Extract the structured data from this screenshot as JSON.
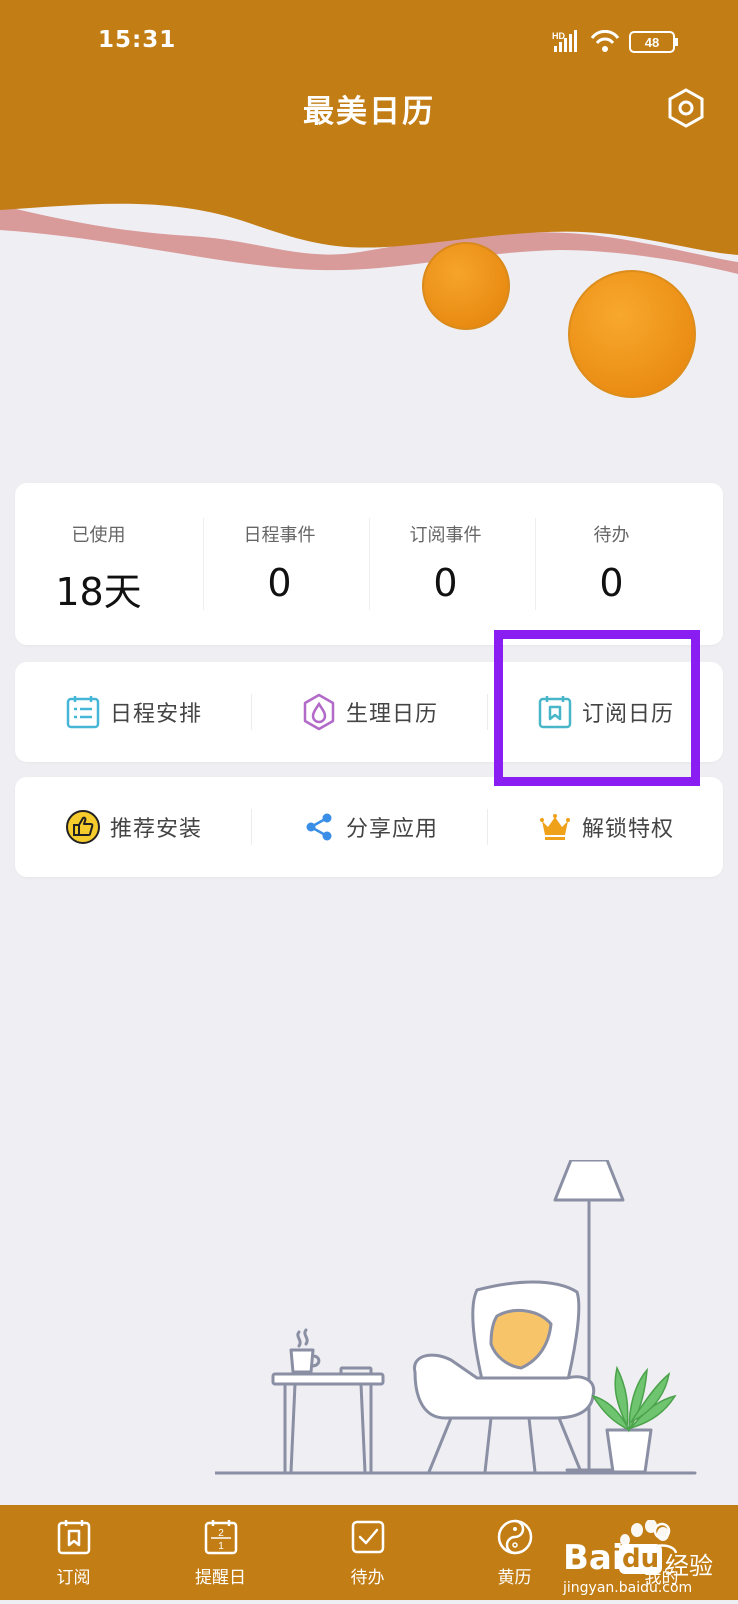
{
  "status_bar": {
    "time": "15:31",
    "network": "HD",
    "battery": "48"
  },
  "header": {
    "title": "最美日历",
    "settings_icon": "hexagon-settings-icon"
  },
  "stats": [
    {
      "label": "已使用",
      "value": "18天"
    },
    {
      "label": "日程事件",
      "value": "0"
    },
    {
      "label": "订阅事件",
      "value": "0"
    },
    {
      "label": "待办",
      "value": "0"
    }
  ],
  "features": {
    "row1": [
      {
        "label": "日程安排",
        "icon": "schedule-icon"
      },
      {
        "label": "生理日历",
        "icon": "drop-icon"
      },
      {
        "label": "订阅日历",
        "icon": "subscribe-calendar-icon"
      }
    ],
    "row2": [
      {
        "label": "推荐安装",
        "icon": "thumbs-up-icon"
      },
      {
        "label": "分享应用",
        "icon": "share-icon"
      },
      {
        "label": "解锁特权",
        "icon": "crown-icon"
      }
    ]
  },
  "bottom_nav": [
    {
      "label": "订阅",
      "icon": "subscribe-icon"
    },
    {
      "label": "提醒日",
      "icon": "calendar-reminder-icon"
    },
    {
      "label": "待办",
      "icon": "checkbox-icon"
    },
    {
      "label": "黄历",
      "icon": "yin-yang-icon"
    },
    {
      "label": "我的",
      "icon": "profile-icon"
    }
  ],
  "watermark": {
    "brand": "Bai",
    "brand2": "du",
    "suffix": "经验",
    "url": "jingyan.baidu.com"
  },
  "colors": {
    "header": "#c27d14",
    "ball": "#f1981d",
    "wave": "#d99a9a",
    "highlight": "#8a1ef2",
    "background": "#efeef3"
  }
}
